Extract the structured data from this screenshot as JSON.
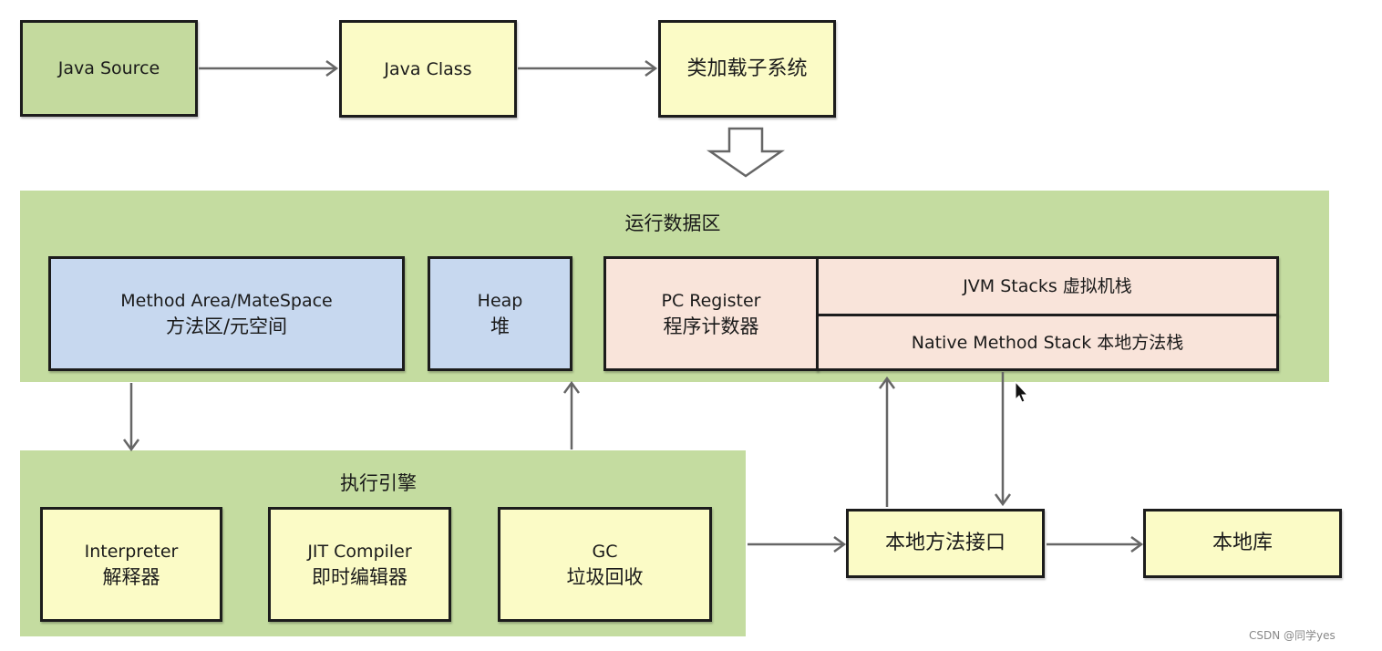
{
  "top_row": {
    "java_source": "Java Source",
    "java_class": "Java Class",
    "class_loader": "类加载子系统"
  },
  "runtime_data_area": {
    "title": "运行数据区",
    "method_area": {
      "line1": "Method Area/MateSpace",
      "line2": "方法区/元空间"
    },
    "heap": {
      "line1": "Heap",
      "line2": "堆"
    },
    "pc_register": {
      "line1": "PC Register",
      "line2": "程序计数器"
    },
    "jvm_stacks": "JVM Stacks 虚拟机栈",
    "native_method_stack": "Native Method Stack 本地方法栈"
  },
  "execution_engine": {
    "title": "执行引擎",
    "interpreter": {
      "line1": "Interpreter",
      "line2": "解释器"
    },
    "jit": {
      "line1": "JIT Compiler",
      "line2": "即时编辑器"
    },
    "gc": {
      "line1": "GC",
      "line2": "垃圾回收"
    }
  },
  "native_interface": "本地方法接口",
  "native_library": "本地库",
  "watermark": "CSDN @同学yes",
  "colors": {
    "green": "#c4da9e",
    "yellow": "#fbfbc6",
    "blue": "#c7d8ef",
    "pink": "#f9e4da"
  }
}
